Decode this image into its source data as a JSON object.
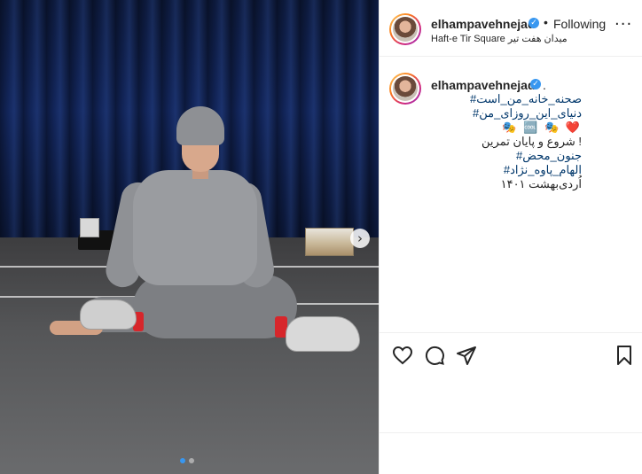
{
  "post": {
    "username": "elhampavehnejad",
    "follow_state": "Following",
    "separator": "•",
    "location": "Haft-e Tir Square میدان هفت تیر",
    "more_label": "···"
  },
  "caption": {
    "username": "elhampavehnejad",
    "trailing_dot": ".",
    "lines": [
      {
        "text": "صحنه_خانه_من_است#",
        "kind": "hashtag"
      },
      {
        "text": "دنیای_این_روزای_من#",
        "kind": "hashtag"
      },
      {
        "text": "❤️ 🎭 🆒 🎭",
        "kind": "emoji"
      },
      {
        "text": "! شروع و پایان تمرین",
        "kind": "plain"
      },
      {
        "text": "جنون_محض#",
        "kind": "hashtag"
      },
      {
        "text": "الهام_پاوه_نژاد#",
        "kind": "hashtag"
      },
      {
        "text": "اُردی‌بهشت ۱۴۰۱",
        "kind": "plain"
      }
    ]
  },
  "media": {
    "next_label": "›",
    "carousel_total": 2,
    "carousel_active": 1
  },
  "icons": {
    "like": "heart-icon",
    "comment": "comment-icon",
    "share": "share-icon",
    "save": "bookmark-icon",
    "verified": "verified-badge-icon",
    "next": "chevron-right-icon"
  },
  "colors": {
    "verified": "#3897f0",
    "hashtag": "#00376b",
    "text": "#262626",
    "carousel_active": "#3897f0"
  }
}
